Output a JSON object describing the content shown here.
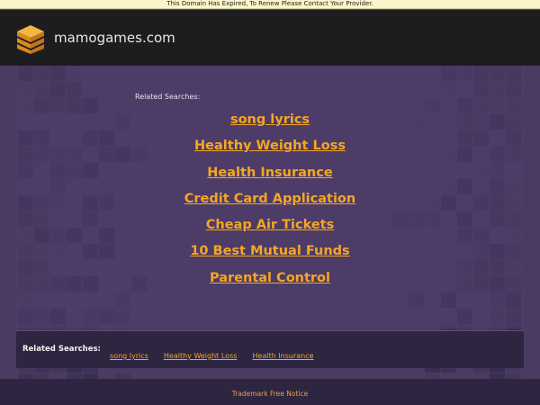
{
  "notice": {
    "text": "This Domain Has Expired, To Renew Please Contact Your Provider."
  },
  "header": {
    "site_name": "mamogames.com",
    "logo_icon": "layered-box-icon"
  },
  "main": {
    "related_title": "Related Searches:",
    "links": [
      {
        "label": "song lyrics"
      },
      {
        "label": "Healthy Weight Loss"
      },
      {
        "label": "Health Insurance"
      },
      {
        "label": "Credit Card Application"
      },
      {
        "label": "Cheap Air Tickets"
      },
      {
        "label": "10 Best Mutual Funds"
      },
      {
        "label": "Parental Control"
      }
    ]
  },
  "bottom_bar": {
    "label": "Related Searches:",
    "links": [
      {
        "label": "song lyrics"
      },
      {
        "label": "Healthy Weight Loss"
      },
      {
        "label": "Health Insurance"
      }
    ]
  },
  "footer": {
    "link": "Trademark Free Notice"
  },
  "colors": {
    "accent": "#f5a623",
    "header_bg": "#1d1d1f",
    "content_bg": "#4a3b62",
    "notice_bg": "#fbf6c9"
  }
}
